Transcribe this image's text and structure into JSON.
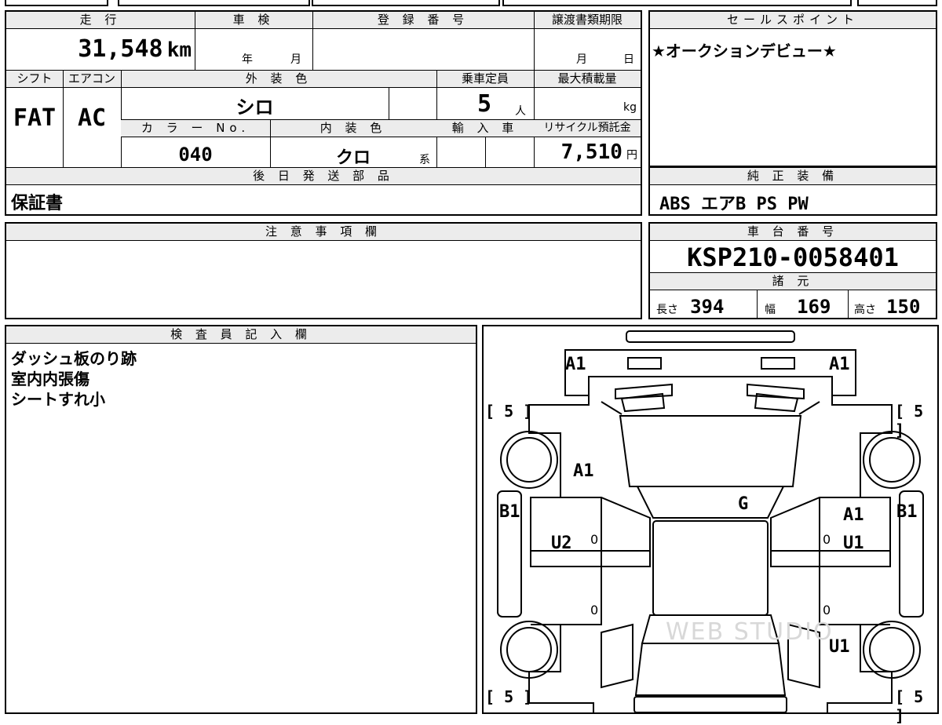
{
  "top": {
    "mileage_label": "走 行",
    "mileage_value": "31,548",
    "mileage_unit": "km",
    "inspection_label": "車 検",
    "inspection_year": "年",
    "inspection_month": "月",
    "registration_label": "登 録 番 号",
    "transfer_label": "譲渡書類期限",
    "transfer_month": "月",
    "transfer_day": "日"
  },
  "row2": {
    "shift_label": "シフト",
    "ac_label": "エアコン",
    "exterior_label": "外 装 色",
    "capacity_label": "乗車定員",
    "maxload_label": "最大積載量",
    "shift_value": "FAT",
    "ac_value": "AC",
    "exterior_value": "シロ",
    "capacity_value": "5",
    "capacity_unit": "人",
    "maxload_unit": "kg",
    "color_no_label": "カ ラ ー No.",
    "interior_label": "内 装 色",
    "import_label": "輸 入 車",
    "recycle_label": "リサイクル預託金",
    "color_no_value": "040",
    "interior_value": "クロ",
    "interior_suffix": "系",
    "recycle_value": "7,510",
    "recycle_unit": "円"
  },
  "later": {
    "label": "後 日 発 送 部 品",
    "value": "保証書"
  },
  "sales": {
    "label": "セールスポイント",
    "value": "★オークションデビュー★"
  },
  "equipment": {
    "label": "純 正 装 備",
    "value": "ABS エアB PS PW"
  },
  "notes": {
    "label": "注 意 事 項 欄"
  },
  "chassis": {
    "label": "車 台 番 号",
    "value": "KSP210-0058401"
  },
  "specs": {
    "label": "諸 元",
    "length_label": "長さ",
    "length_value": "394",
    "width_label": "幅",
    "width_value": "169",
    "height_label": "高さ",
    "height_value": "150"
  },
  "inspector": {
    "label": "検 査 員 記 入 欄",
    "lines": [
      "ダッシュ板のり跡",
      "室内内張傷",
      "シートすれ小"
    ]
  },
  "diagram": {
    "a1_front_left": "A1",
    "a1_front_right": "A1",
    "tire_tl": "[ 5 ]",
    "tire_tr": "[ 5 ]",
    "tire_bl": "[ 5 ]",
    "tire_br": "[ 5 ]",
    "a1_hood": "A1",
    "g_windshield": "G",
    "b1_left": "B1",
    "b1_right": "B1",
    "a1_right_door": "A1",
    "u2_left": "U2",
    "u1_right": "U1",
    "u1_rear_right": "U1",
    "zero1": "0",
    "zero2": "0",
    "zero3": "0",
    "zero4": "0",
    "watermark": "WEB STUDIO"
  }
}
